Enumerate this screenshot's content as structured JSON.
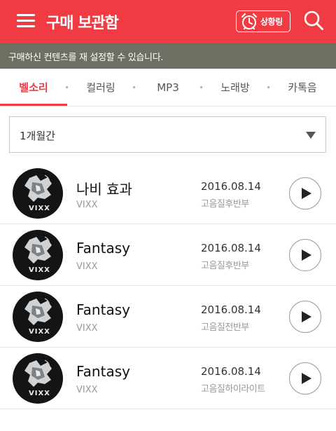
{
  "header": {
    "title": "구매 보관함",
    "ringtone_label": "상황링",
    "menu_icon": "hamburger-menu-icon",
    "ringtone_icon": "alarm-clock-icon",
    "search_icon": "search-icon",
    "accent_color": "#ef3b41"
  },
  "notice": {
    "text": "구매하신 컨텐츠를 재 설정할 수 있습니다."
  },
  "tabs": [
    {
      "label": "벨소리",
      "active": true
    },
    {
      "label": "컬러링",
      "active": false
    },
    {
      "label": "MP3",
      "active": false
    },
    {
      "label": "노래방",
      "active": false
    },
    {
      "label": "카톡음",
      "active": false
    }
  ],
  "filter": {
    "selected": "1개월간",
    "dropdown_icon": "triangle-down-icon"
  },
  "songs": [
    {
      "title": "나비 효과",
      "artist": "VIXX",
      "date": "2016.08.14",
      "quality": "고음질후반부"
    },
    {
      "title": "Fantasy",
      "artist": "VIXX",
      "date": "2016.08.14",
      "quality": "고음질후반부"
    },
    {
      "title": "Fantasy",
      "artist": "VIXX",
      "date": "2016.08.14",
      "quality": "고음질전반부"
    },
    {
      "title": "Fantasy",
      "artist": "VIXX",
      "date": "2016.08.14",
      "quality": "고음질하이라이트"
    }
  ],
  "album_logo_text": "VIXX",
  "play_icon": "play-icon"
}
